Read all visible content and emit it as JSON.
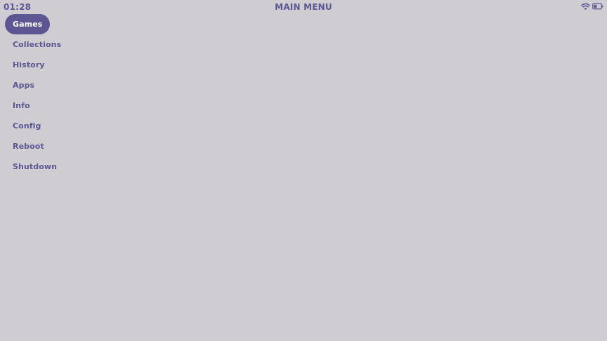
{
  "status_bar": {
    "time": "01:28",
    "title": "MAIN MENU",
    "wifi_icon": "wifi-icon",
    "battery_icon": "battery-icon"
  },
  "menu": {
    "selected_index": 0,
    "items": [
      {
        "label": "Games"
      },
      {
        "label": "Collections"
      },
      {
        "label": "History"
      },
      {
        "label": "Apps"
      },
      {
        "label": "Info"
      },
      {
        "label": "Config"
      },
      {
        "label": "Reboot"
      },
      {
        "label": "Shutdown"
      }
    ]
  },
  "colors": {
    "background": "#cfcdd2",
    "accent": "#5c5793",
    "selected_text": "#ffffff"
  }
}
